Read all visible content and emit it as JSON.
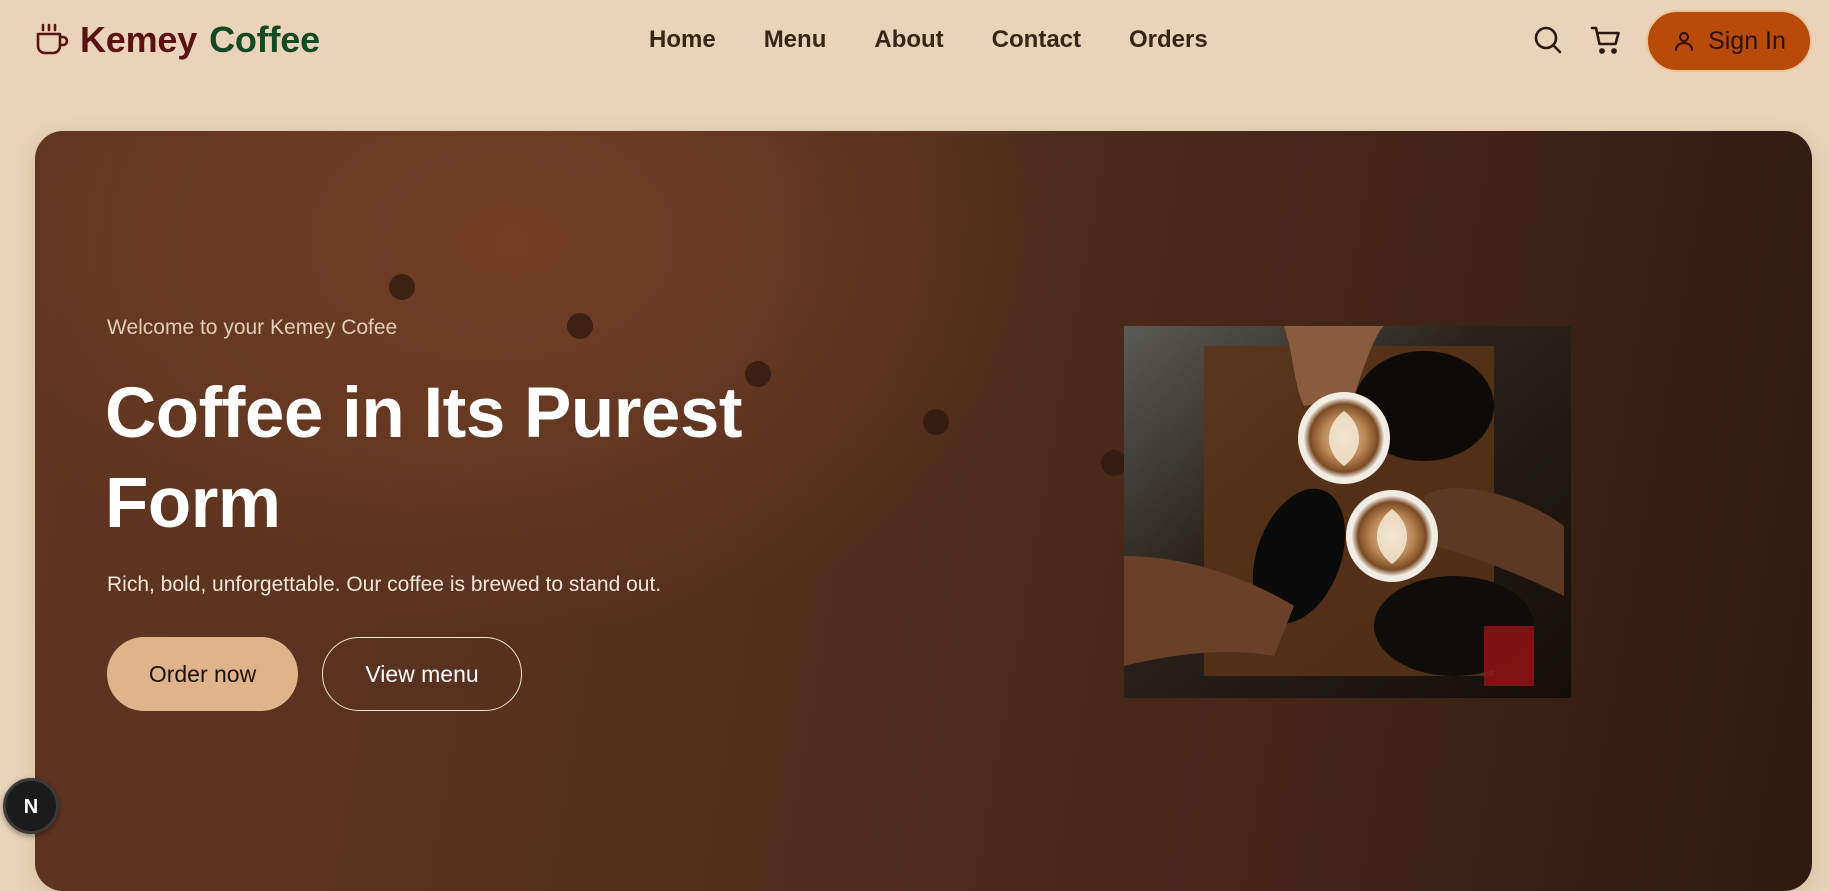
{
  "brand": {
    "word1": "Kemey",
    "word2": "Coffee",
    "icon": "coffee-cup-icon"
  },
  "nav": {
    "items": [
      {
        "label": "Home"
      },
      {
        "label": "Menu"
      },
      {
        "label": "About"
      },
      {
        "label": "Contact"
      },
      {
        "label": "Orders"
      }
    ]
  },
  "header_actions": {
    "search_icon": "search-icon",
    "cart_icon": "shopping-cart-icon",
    "signin_label": "Sign In",
    "signin_icon": "user-icon"
  },
  "hero": {
    "welcome": "Welcome to your Kemey Cofee",
    "title": "Coffee in Its Purest Form",
    "subtitle": "Rich, bold, unforgettable. Our coffee is brewed to stand out.",
    "primary_button": "Order now",
    "secondary_button": "View menu",
    "image_alt": "Hands toasting latte art coffee cups"
  },
  "dev_badge": {
    "letter": "N"
  },
  "colors": {
    "page_bg": "#e9d3b9",
    "brand_word1": "#5b1212",
    "brand_word2": "#124a24",
    "signin_bg": "#b84a0a",
    "hero_bg": "#55301e",
    "primary_button_bg": "#dfb48a"
  }
}
